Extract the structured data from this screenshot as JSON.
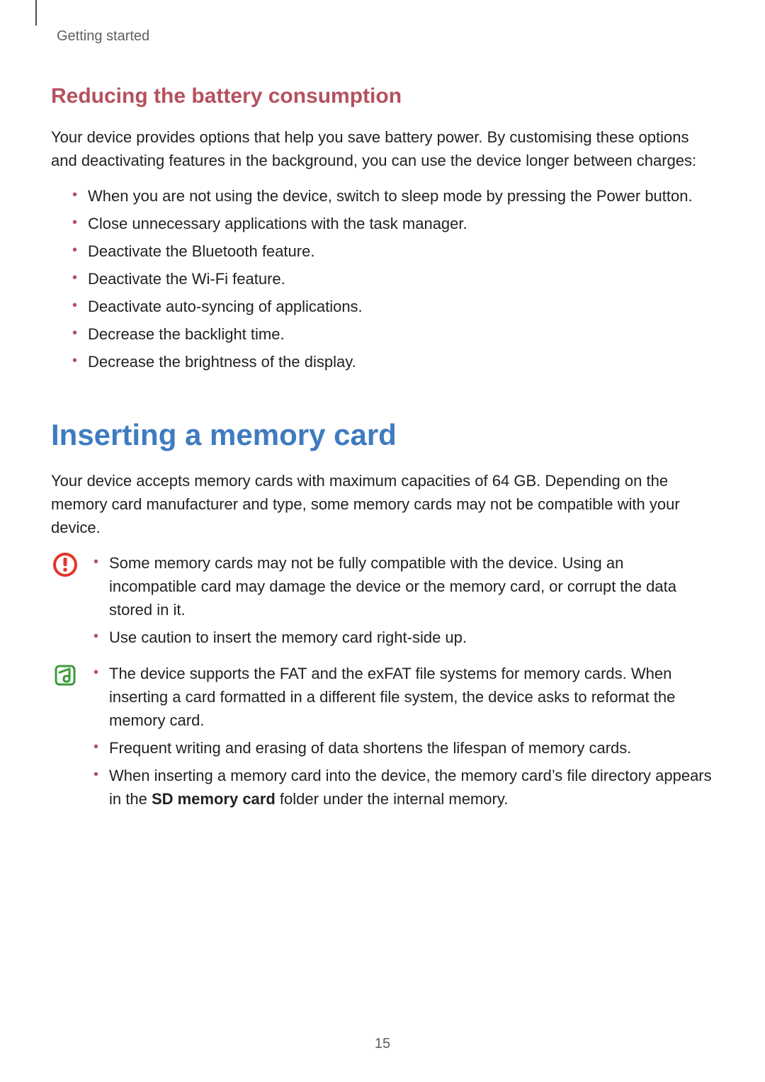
{
  "breadcrumb": "Getting started",
  "section1": {
    "heading": "Reducing the battery consumption",
    "intro": "Your device provides options that help you save battery power. By customising these options and deactivating features in the background, you can use the device longer between charges:",
    "bullets": [
      "When you are not using the device, switch to sleep mode by pressing the Power button.",
      "Close unnecessary applications with the task manager.",
      "Deactivate the Bluetooth feature.",
      "Deactivate the Wi-Fi feature.",
      "Deactivate auto-syncing of applications.",
      "Decrease the backlight time.",
      "Decrease the brightness of the display."
    ]
  },
  "section2": {
    "heading": "Inserting a memory card",
    "intro": "Your device accepts memory cards with maximum capacities of 64 GB. Depending on the memory card manufacturer and type, some memory cards may not be compatible with your device.",
    "warning_bullets": [
      "Some memory cards may not be fully compatible with the device. Using an incompatible card may damage the device or the memory card, or corrupt the data stored in it.",
      "Use caution to insert the memory card right-side up."
    ],
    "note_bullets": {
      "b0": "The device supports the FAT and the exFAT file systems for memory cards. When inserting a card formatted in a different file system, the device asks to reformat the memory card.",
      "b1": "Frequent writing and erasing of data shortens the lifespan of memory cards.",
      "b2_prefix": "When inserting a memory card into the device, the memory card’s file directory appears in the ",
      "b2_bold": "SD memory card",
      "b2_suffix": " folder under the internal memory."
    }
  },
  "page_number": "15"
}
